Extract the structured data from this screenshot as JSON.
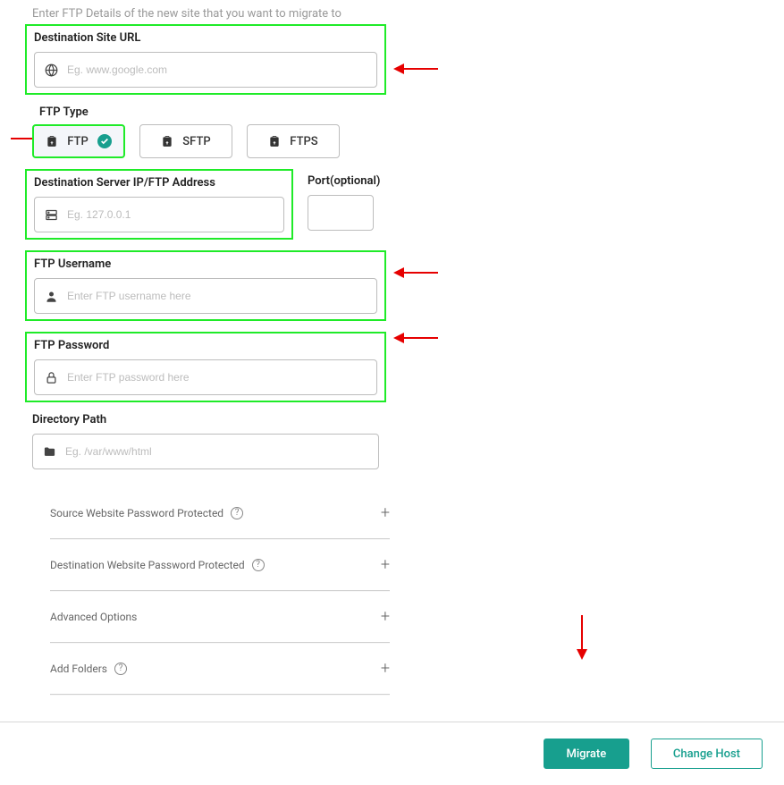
{
  "intro_text": "Enter FTP Details of the new site that you want to migrate to",
  "dest_url": {
    "label": "Destination Site URL",
    "placeholder": "Eg. www.google.com"
  },
  "ftp_type": {
    "label": "FTP Type",
    "options": [
      "FTP",
      "SFTP",
      "FTPS"
    ],
    "selected": "FTP"
  },
  "server_ip": {
    "label": "Destination Server IP/FTP Address",
    "placeholder": "Eg. 127.0.0.1"
  },
  "port": {
    "label": "Port(optional)"
  },
  "ftp_user": {
    "label": "FTP Username",
    "placeholder": "Enter FTP username here"
  },
  "ftp_pass": {
    "label": "FTP Password",
    "placeholder": "Enter FTP password here"
  },
  "dir_path": {
    "label": "Directory Path",
    "placeholder": "Eg. /var/www/html"
  },
  "expanders": [
    {
      "title": "Source Website Password Protected",
      "help": true
    },
    {
      "title": "Destination Website Password Protected",
      "help": true
    },
    {
      "title": "Advanced Options",
      "help": false
    },
    {
      "title": "Add Folders",
      "help": true
    }
  ],
  "footer": {
    "migrate": "Migrate",
    "change_host": "Change Host"
  }
}
